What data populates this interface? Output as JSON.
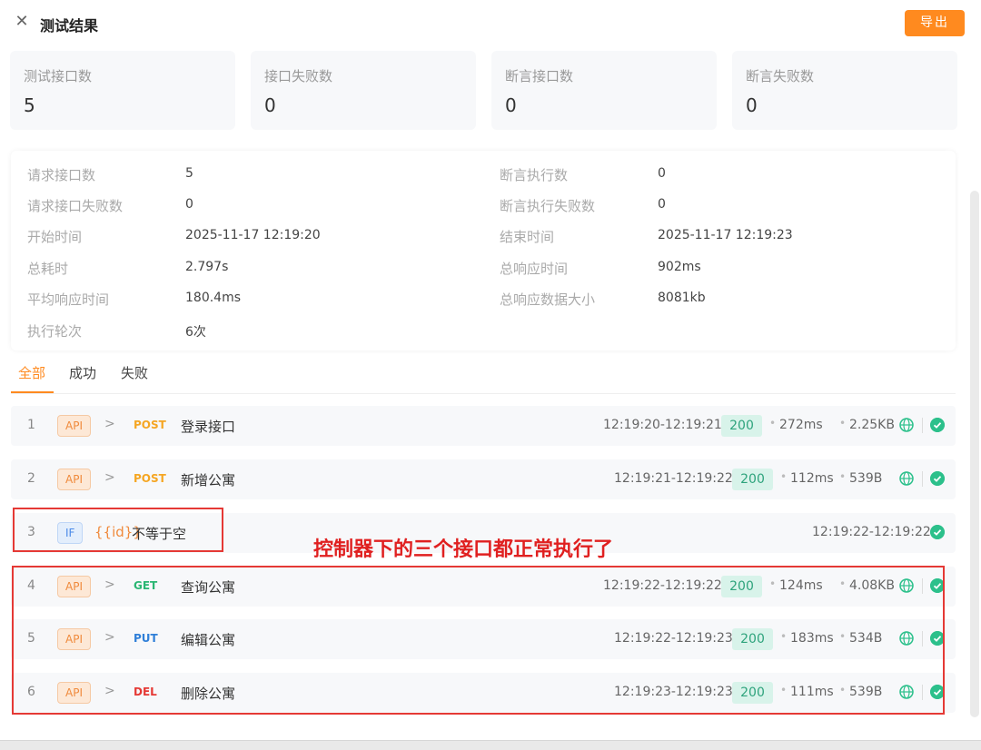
{
  "header": {
    "title": "测试结果",
    "export_label": "导出"
  },
  "stats": [
    {
      "label": "测试接口数",
      "value": "5"
    },
    {
      "label": "接口失败数",
      "value": "0"
    },
    {
      "label": "断言接口数",
      "value": "0"
    },
    {
      "label": "断言失败数",
      "value": "0"
    }
  ],
  "info_left": [
    {
      "label": "请求接口数",
      "value": "5"
    },
    {
      "label": "请求接口失败数",
      "value": "0"
    },
    {
      "label": "开始时间",
      "value": "2025-11-17 12:19:20"
    },
    {
      "label": "总耗时",
      "value": "2.797s"
    },
    {
      "label": "平均响应时间",
      "value": "180.4ms"
    },
    {
      "label": "执行轮次",
      "value": "6次"
    }
  ],
  "info_right": [
    {
      "label": "断言执行数",
      "value": "0"
    },
    {
      "label": "断言执行失败数",
      "value": "0"
    },
    {
      "label": "结束时间",
      "value": "2025-11-17 12:19:23"
    },
    {
      "label": "总响应时间",
      "value": "902ms"
    },
    {
      "label": "总响应数据大小",
      "value": "8081kb"
    }
  ],
  "tabs": [
    "全部",
    "成功",
    "失败"
  ],
  "rows": [
    {
      "index": "1",
      "type": "API",
      "method": "POST",
      "method_color": "#f5a623",
      "name": "登录接口",
      "time": "12:19:20-12:19:21",
      "code": "200",
      "ms": "272ms",
      "size": "2.25KB"
    },
    {
      "index": "2",
      "type": "API",
      "method": "POST",
      "method_color": "#f5a623",
      "name": "新增公寓",
      "time": "12:19:21-12:19:22",
      "code": "200",
      "ms": "112ms",
      "size": "539B"
    },
    {
      "index": "3",
      "type": "IF",
      "condition_var": "{{id}}",
      "condition": "不等于空",
      "time": "12:19:22-12:19:22"
    },
    {
      "index": "4",
      "type": "API",
      "method": "GET",
      "method_color": "#2bb673",
      "name": "查询公寓",
      "time": "12:19:22-12:19:22",
      "code": "200",
      "ms": "124ms",
      "size": "4.08KB"
    },
    {
      "index": "5",
      "type": "API",
      "method": "PUT",
      "method_color": "#2f7fd8",
      "name": "编辑公寓",
      "time": "12:19:22-12:19:23",
      "code": "200",
      "ms": "183ms",
      "size": "534B"
    },
    {
      "index": "6",
      "type": "API",
      "method": "DEL",
      "method_color": "#e53935",
      "name": "删除公寓",
      "time": "12:19:23-12:19:23",
      "code": "200",
      "ms": "111ms",
      "size": "539B"
    }
  ],
  "annotation": "控制器下的三个接口都正常执行了",
  "colors": {
    "accent": "#ff8a1f",
    "success": "#2cc08b",
    "annotation_red": "#e53935"
  }
}
